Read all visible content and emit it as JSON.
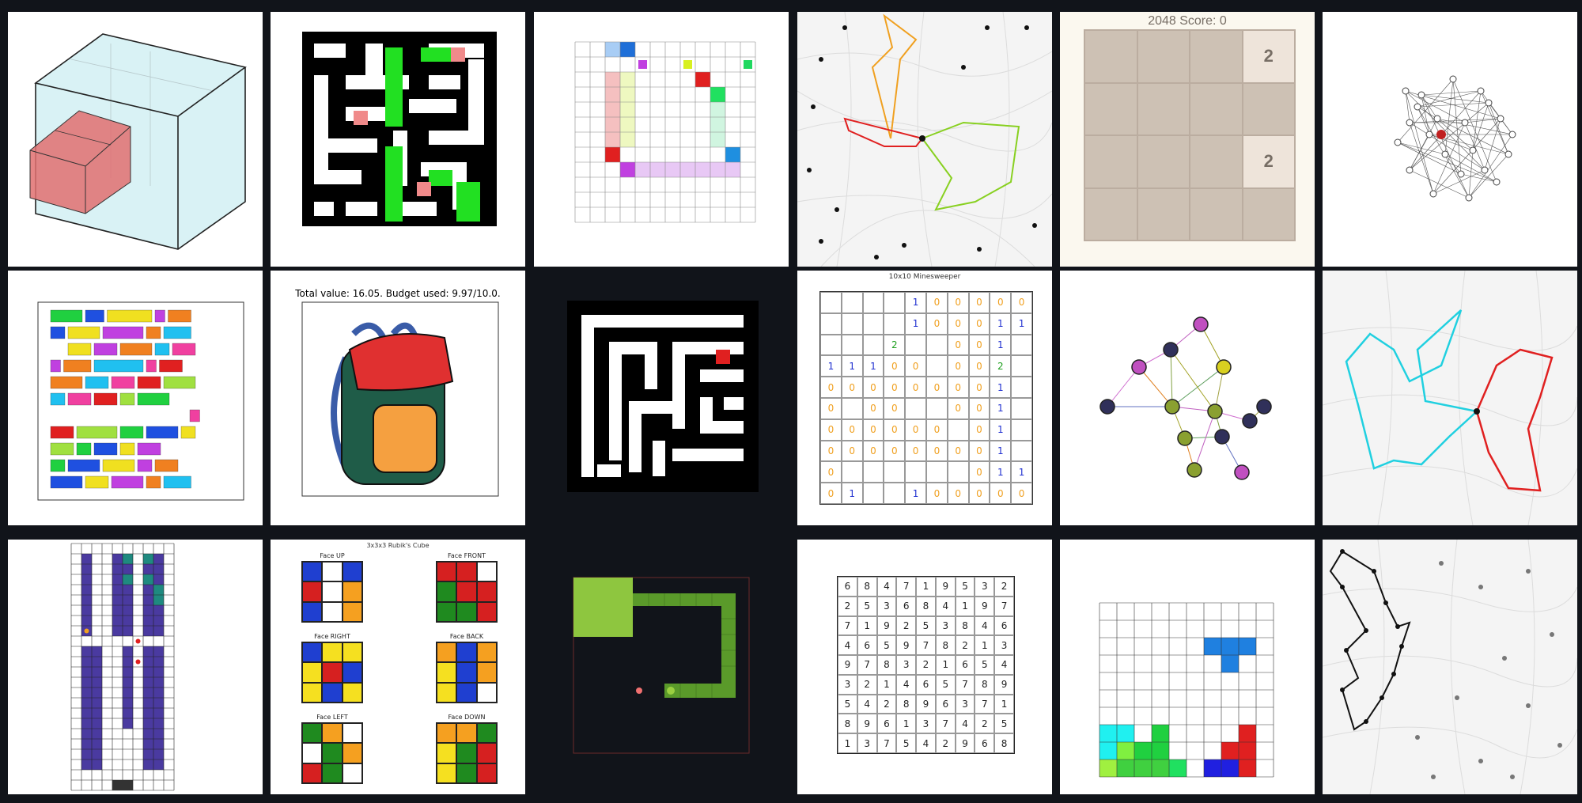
{
  "tiles": [
    {
      "name": "3d-bin-packing"
    },
    {
      "name": "maze-green-path"
    },
    {
      "name": "grid-path-puzzle"
    },
    {
      "name": "map-vehicle-routes"
    },
    {
      "name": "game-2048",
      "title": "2048    Score: 0",
      "cells": [
        "",
        "",
        "",
        "2",
        "",
        "",
        "",
        "",
        "",
        "",
        "",
        "2",
        "",
        "",
        "",
        ""
      ]
    },
    {
      "name": "network-graph"
    },
    {
      "name": "gantt-schedule"
    },
    {
      "name": "knapsack-backpack",
      "title": "Total value: 16.05. Budget used: 9.97/10.0."
    },
    {
      "name": "maze-dark"
    },
    {
      "name": "minesweeper",
      "title": "10x10 Minesweeper",
      "rows": [
        [
          "",
          "",
          "",
          "",
          "1",
          "0",
          "0",
          "0",
          "0",
          "0"
        ],
        [
          "",
          "",
          "",
          "",
          "1",
          "0",
          "0",
          "0",
          "1",
          "1"
        ],
        [
          "",
          "",
          "",
          "2",
          "",
          "",
          "0",
          "0",
          "1",
          ""
        ],
        [
          "1",
          "1",
          "1",
          "0",
          "0",
          "",
          "0",
          "0",
          "2",
          ""
        ],
        [
          "0",
          "0",
          "0",
          "0",
          "0",
          "0",
          "0",
          "0",
          "1",
          ""
        ],
        [
          "0",
          "",
          "0",
          "0",
          "",
          "",
          "0",
          "0",
          "1",
          ""
        ],
        [
          "0",
          "0",
          "0",
          "0",
          "0",
          "0",
          "",
          "0",
          "1",
          ""
        ],
        [
          "0",
          "0",
          "0",
          "0",
          "0",
          "0",
          "0",
          "0",
          "1",
          ""
        ],
        [
          "0",
          "",
          "",
          "",
          "",
          "",
          "",
          "0",
          "1",
          "1"
        ],
        [
          "0",
          "1",
          "",
          "",
          "1",
          "0",
          "0",
          "0",
          "0",
          "0"
        ]
      ]
    },
    {
      "name": "graph-coloring"
    },
    {
      "name": "map-two-routes"
    },
    {
      "name": "pacman-grid"
    },
    {
      "name": "rubiks-cube",
      "title": "3x3x3 Rubik's Cube",
      "faces": [
        {
          "label": "Face UP",
          "colors": [
            "#1f3fd0",
            "#ffffff",
            "#1f3fd0",
            "#d62020",
            "#ffffff",
            "#f5a020",
            "#1f3fd0",
            "#ffffff",
            "#f5a020"
          ]
        },
        {
          "label": "Face FRONT",
          "colors": [
            "#d62020",
            "#d62020",
            "#ffffff",
            "#1f8a1f",
            "#d62020",
            "#d62020",
            "#1f8a1f",
            "#1f8a1f",
            "#d62020"
          ]
        },
        {
          "label": "Face RIGHT",
          "colors": [
            "#1f3fd0",
            "#f5e020",
            "#f5e020",
            "#f5e020",
            "#d62020",
            "#1f3fd0",
            "#f5e020",
            "#1f3fd0",
            "#f5e020"
          ]
        },
        {
          "label": "Face BACK",
          "colors": [
            "#f5a020",
            "#1f3fd0",
            "#f5a020",
            "#f5e020",
            "#1f3fd0",
            "#f5a020",
            "#f5e020",
            "#1f3fd0",
            "#ffffff"
          ]
        },
        {
          "label": "Face LEFT",
          "colors": [
            "#1f8a1f",
            "#f5a020",
            "#ffffff",
            "#ffffff",
            "#1f8a1f",
            "#f5a020",
            "#d62020",
            "#1f8a1f",
            "#ffffff"
          ]
        },
        {
          "label": "Face DOWN",
          "colors": [
            "#f5a020",
            "#f5a020",
            "#1f8a1f",
            "#f5e020",
            "#1f8a1f",
            "#d62020",
            "#f5e020",
            "#1f8a1f",
            "#d62020"
          ]
        }
      ]
    },
    {
      "name": "snake-game"
    },
    {
      "name": "sudoku",
      "rows": [
        [
          "6",
          "8",
          "4",
          "7",
          "1",
          "9",
          "5",
          "3",
          "2"
        ],
        [
          "2",
          "5",
          "3",
          "6",
          "8",
          "4",
          "1",
          "9",
          "7"
        ],
        [
          "7",
          "1",
          "9",
          "2",
          "5",
          "3",
          "8",
          "4",
          "6"
        ],
        [
          "4",
          "6",
          "5",
          "9",
          "7",
          "8",
          "2",
          "1",
          "3"
        ],
        [
          "9",
          "7",
          "8",
          "3",
          "2",
          "1",
          "6",
          "5",
          "4"
        ],
        [
          "3",
          "2",
          "1",
          "4",
          "6",
          "5",
          "7",
          "8",
          "9"
        ],
        [
          "5",
          "4",
          "2",
          "8",
          "9",
          "6",
          "3",
          "7",
          "1"
        ],
        [
          "8",
          "9",
          "6",
          "1",
          "3",
          "7",
          "4",
          "2",
          "5"
        ],
        [
          "1",
          "3",
          "7",
          "5",
          "4",
          "2",
          "9",
          "6",
          "8"
        ]
      ]
    },
    {
      "name": "tetris-board"
    },
    {
      "name": "map-tsp-route"
    }
  ]
}
